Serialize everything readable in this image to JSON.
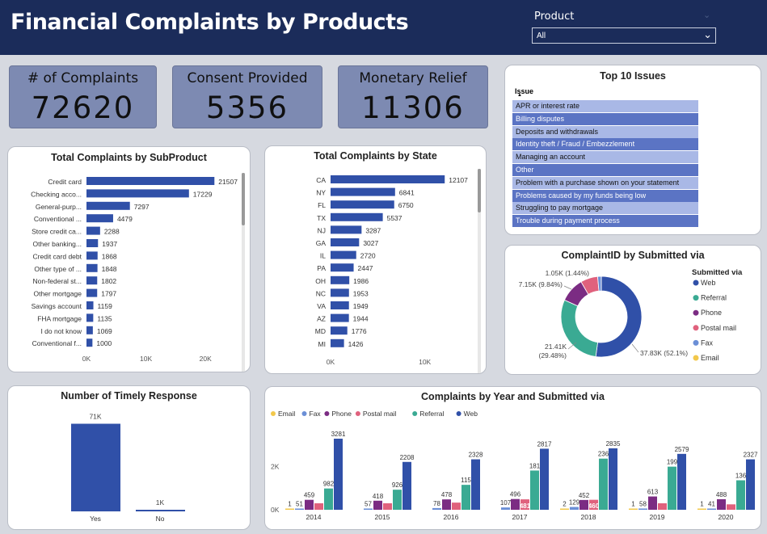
{
  "header": {
    "title": "Financial Complaints by Products",
    "slicer_label": "Product",
    "slicer_value": "All"
  },
  "kpis": [
    {
      "label": "# of Complaints",
      "value": "72620"
    },
    {
      "label": "Consent Provided",
      "value": "5356"
    },
    {
      "label": "Monetary Relief",
      "value": "11306"
    }
  ],
  "top_issues": {
    "title": "Top 10 Issues",
    "column": "Issue",
    "items": [
      "APR or interest rate",
      "Billing disputes",
      "Deposits and withdrawals",
      "Identity theft / Fraud / Embezzlement",
      "Managing an account",
      "Other",
      "Problem with a purchase shown on your statement",
      "Problems caused by my funds being low",
      "Struggling to pay mortgage",
      "Trouble during payment process"
    ]
  },
  "colors": {
    "Email": "#f2c84b",
    "Fax": "#6b8fd6",
    "Phone": "#7b2c83",
    "Postal mail": "#e0617d",
    "Referral": "#3aaa93",
    "Web": "#3050a8"
  },
  "chart_data": [
    {
      "type": "bar",
      "orientation": "horizontal",
      "title": "Total Complaints by SubProduct",
      "categories": [
        "Credit card",
        "Checking acco...",
        "General-purp...",
        "Conventional ...",
        "Store credit ca...",
        "Other banking...",
        "Credit card debt",
        "Other type of ...",
        "Non-federal st...",
        "Other mortgage",
        "Savings account",
        "FHA mortgage",
        "I do not know",
        "Conventional f..."
      ],
      "values": [
        21507,
        17229,
        7297,
        4479,
        2288,
        1937,
        1868,
        1848,
        1802,
        1797,
        1159,
        1135,
        1069,
        1000
      ],
      "xticks": [
        "0K",
        "10K",
        "20K"
      ],
      "xlim": [
        0,
        25000
      ]
    },
    {
      "type": "bar",
      "orientation": "horizontal",
      "title": "Total Complaints by State",
      "categories": [
        "CA",
        "NY",
        "FL",
        "TX",
        "NJ",
        "GA",
        "IL",
        "PA",
        "OH",
        "NC",
        "VA",
        "AZ",
        "MD",
        "MI"
      ],
      "values": [
        12107,
        6841,
        6750,
        5537,
        3287,
        3027,
        2720,
        2447,
        1986,
        1953,
        1949,
        1944,
        1776,
        1426
      ],
      "xticks": [
        "0K",
        "10K"
      ],
      "xlim": [
        0,
        15000
      ]
    },
    {
      "type": "pie",
      "donut": true,
      "title": "ComplaintID by Submitted via",
      "legend_title": "Submitted via",
      "legend_placement": "right",
      "slices": [
        {
          "name": "Web",
          "value": 37830,
          "label": "37.83K (52.1%)"
        },
        {
          "name": "Referral",
          "value": 21410,
          "label": "21.41K (29.48%)"
        },
        {
          "name": "Phone",
          "value": 7150,
          "label": "7.15K (9.84%)"
        },
        {
          "name": "Postal mail",
          "value": 5000,
          "label": ""
        },
        {
          "name": "Fax",
          "value": 1050,
          "label": "1.05K (1.44%)"
        },
        {
          "name": "Email",
          "value": 10,
          "label": ""
        }
      ]
    },
    {
      "type": "bar",
      "title": "Number of Timely Response",
      "categories": [
        "Yes",
        "No"
      ],
      "values": [
        71000,
        1000
      ],
      "value_labels": [
        "71K",
        "1K"
      ],
      "ylim": [
        0,
        72000
      ]
    },
    {
      "type": "bar",
      "grouped": true,
      "title": "Complaints by Year and Submitted via",
      "legend_placement": "top-left",
      "categories": [
        "2014",
        "2015",
        "2016",
        "2017",
        "2018",
        "2019",
        "2020"
      ],
      "yticks": [
        "0K",
        "2K"
      ],
      "ylim": [
        0,
        3500
      ],
      "series": [
        {
          "name": "Email",
          "values": [
            1,
            0,
            0,
            0,
            2,
            1,
            1
          ],
          "labels": [
            "1",
            "",
            "",
            "",
            "2",
            "1",
            "1"
          ]
        },
        {
          "name": "Fax",
          "values": [
            51,
            57,
            78,
            107,
            129,
            58,
            41
          ],
          "labels": [
            "51",
            "57",
            "78",
            "107",
            "129",
            "58",
            "41"
          ]
        },
        {
          "name": "Phone",
          "values": [
            459,
            418,
            478,
            496,
            452,
            613,
            488
          ],
          "labels": [
            "459",
            "418",
            "478",
            "496",
            "452",
            "613",
            "488"
          ]
        },
        {
          "name": "Postal mail",
          "values": [
            300,
            300,
            330,
            481,
            460,
            300,
            250
          ],
          "labels": [
            "",
            "",
            "",
            "481",
            "460",
            "",
            ""
          ]
        },
        {
          "name": "Referral",
          "values": [
            982,
            926,
            1150,
            1810,
            2360,
            1990,
            1360
          ],
          "labels": [
            "982",
            "926",
            "115",
            "181",
            "236",
            "199",
            "136"
          ]
        },
        {
          "name": "Web",
          "values": [
            3281,
            2208,
            2328,
            2817,
            2835,
            2579,
            2327
          ],
          "labels": [
            "3281",
            "2208",
            "2328",
            "2817",
            "2835",
            "2579",
            "2327"
          ]
        }
      ]
    }
  ]
}
